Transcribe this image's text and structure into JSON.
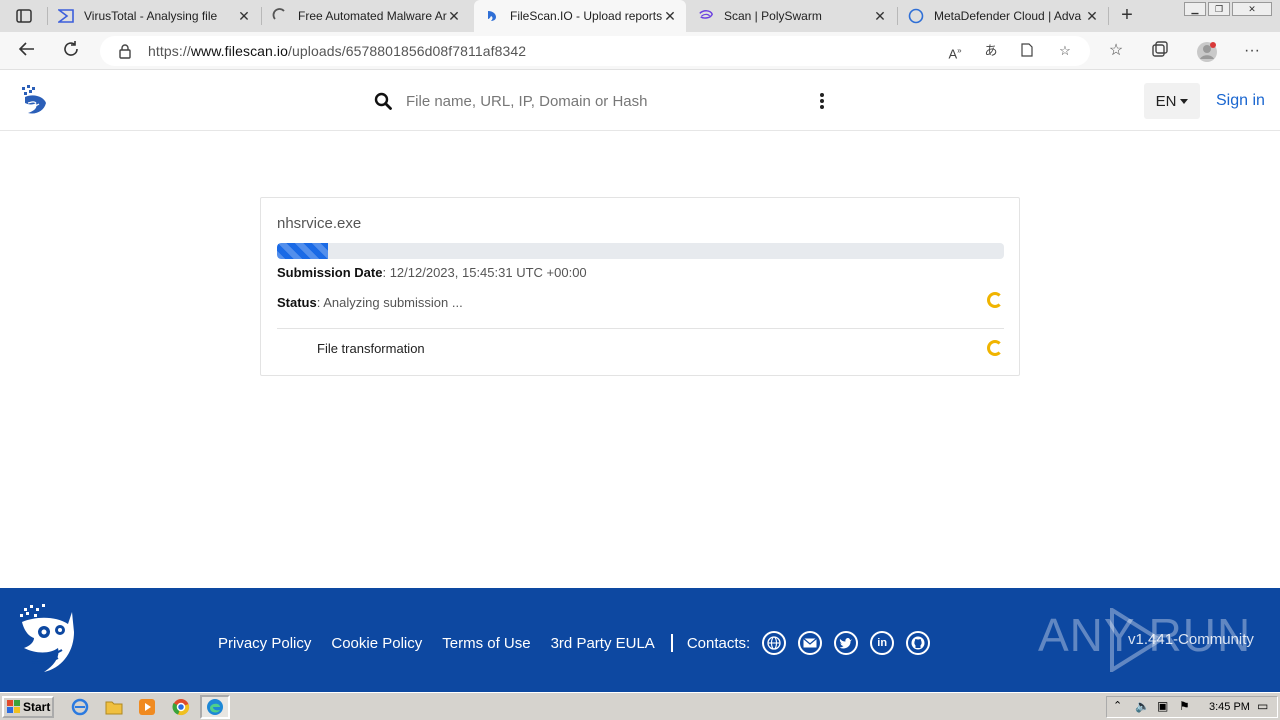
{
  "browser": {
    "tabs": [
      {
        "title": "VirusTotal - Analysing file",
        "icon": "virustotal-icon",
        "active": false
      },
      {
        "title": "Free Automated Malware Ar",
        "icon": "loading-icon",
        "active": false
      },
      {
        "title": "FileScan.IO - Upload reports",
        "icon": "filescan-icon",
        "active": true
      },
      {
        "title": "Scan | PolySwarm",
        "icon": "polyswarm-icon",
        "active": false
      },
      {
        "title": "MetaDefender Cloud | Adva",
        "icon": "metadefender-icon",
        "active": false
      }
    ],
    "url_prefix": "https://",
    "url_host": "www.filescan.io",
    "url_path": "/uploads/6578801856d08f7811af8342"
  },
  "header": {
    "search_placeholder": "File name, URL, IP, Domain or Hash",
    "language": "EN",
    "signin": "Sign in"
  },
  "report": {
    "file_name": "nhsrvice.exe",
    "progress_fraction": 0.07,
    "submission_label": "Submission Date",
    "submission_value": ": 12/12/2023, 15:45:31 UTC +00:00",
    "status_label": "Status",
    "status_value": ": Analyzing submission ...",
    "steps": [
      {
        "label": "File transformation"
      }
    ]
  },
  "footer": {
    "links": [
      "Privacy Policy",
      "Cookie Policy",
      "Terms of Use",
      "3rd Party EULA"
    ],
    "contacts_label": "Contacts:",
    "version": "v1.441-Community",
    "brand": "ANY RUN"
  },
  "taskbar": {
    "start_label": "Start",
    "time": "3:45 PM"
  },
  "colors": {
    "accent": "#1a66d0",
    "footer_bg": "#0d48a1",
    "progress": "#1a6ae6",
    "spinner": "#f0b400"
  }
}
